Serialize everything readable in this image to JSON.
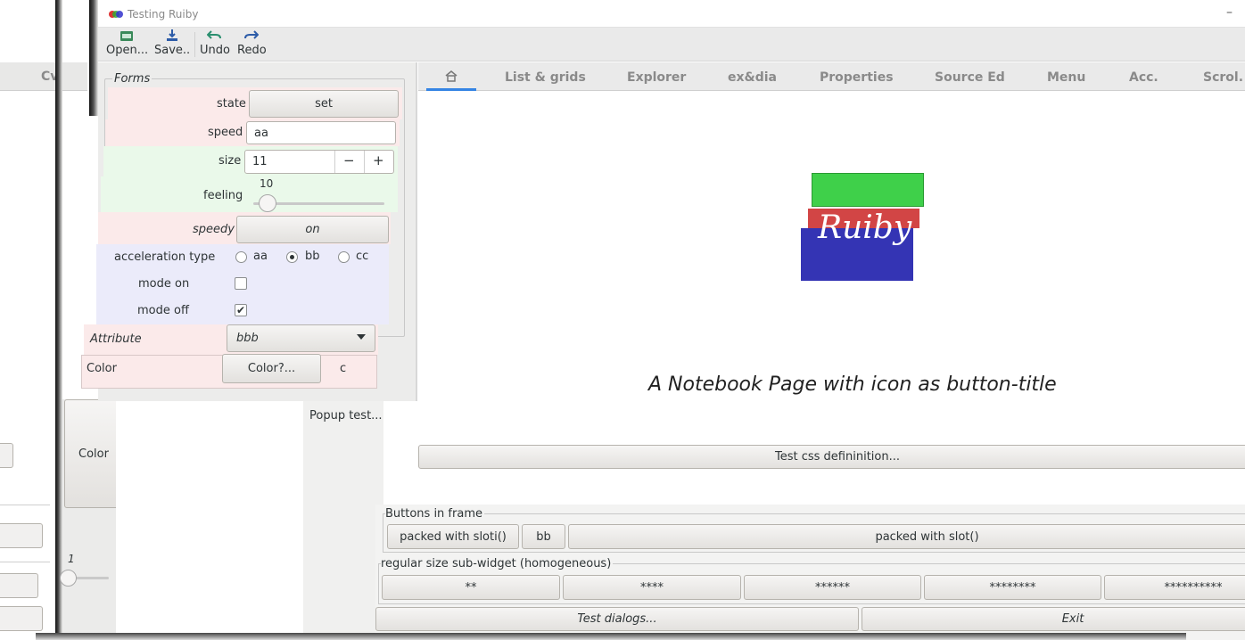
{
  "window": {
    "title": "Testing Ruiby"
  },
  "toolbar": {
    "open": "Open...",
    "save": "Save..",
    "undo": "Undo",
    "redo": "Redo"
  },
  "left_strip": {
    "tab": "Cv",
    "color_button": "Color",
    "scale_value": "1"
  },
  "forms": {
    "frame_label": "Forms",
    "state_label": "state",
    "state_button": "set",
    "speed_label": "speed",
    "speed_value": "aa",
    "size_label": "size",
    "size_value": "11",
    "size_minus": "−",
    "size_plus": "+",
    "feeling_label": "feeling",
    "feeling_value": "10",
    "feeling_level": 0.05,
    "speedy_label": "speedy",
    "speedy_button": "on",
    "accel_label": "acceleration type",
    "radio_aa": "aa",
    "radio_bb": "bb",
    "radio_cc": "cc",
    "mode_on_label": "mode on",
    "mode_off_label": "mode off",
    "mode_on_checked": false,
    "mode_off_checked": true,
    "attribute_label": "Attribute",
    "attribute_value": "bbb",
    "color_label": "Color",
    "color_button": "Color?...",
    "color_value": "c"
  },
  "popup_test": "Popup test...",
  "notebook": {
    "tabs": [
      "List & grids",
      "Explorer",
      "ex&dia",
      "Properties",
      "Source Ed",
      "Menu",
      "Acc.",
      "Scrol."
    ],
    "logo_text": "Ruiby",
    "page_caption": "A Notebook Page with icon as button-title",
    "css_button": "Test css defininition..."
  },
  "buttons_frame": {
    "label": "Buttons in frame",
    "b1": "packed with sloti()",
    "b2": "bb",
    "b3": "packed with slot()"
  },
  "regular_frame": {
    "label": "regular size sub-widget (homogeneous)",
    "buttons": [
      "**",
      "****",
      "******",
      "********",
      "**********"
    ]
  },
  "bottom": {
    "dialogs": "Test dialogs...",
    "exit": "Exit"
  },
  "colors": {
    "logo_green": "#3fd04a",
    "logo_red": "#d24545",
    "logo_blue": "#3434b4",
    "tab_active": "#3584e4"
  }
}
